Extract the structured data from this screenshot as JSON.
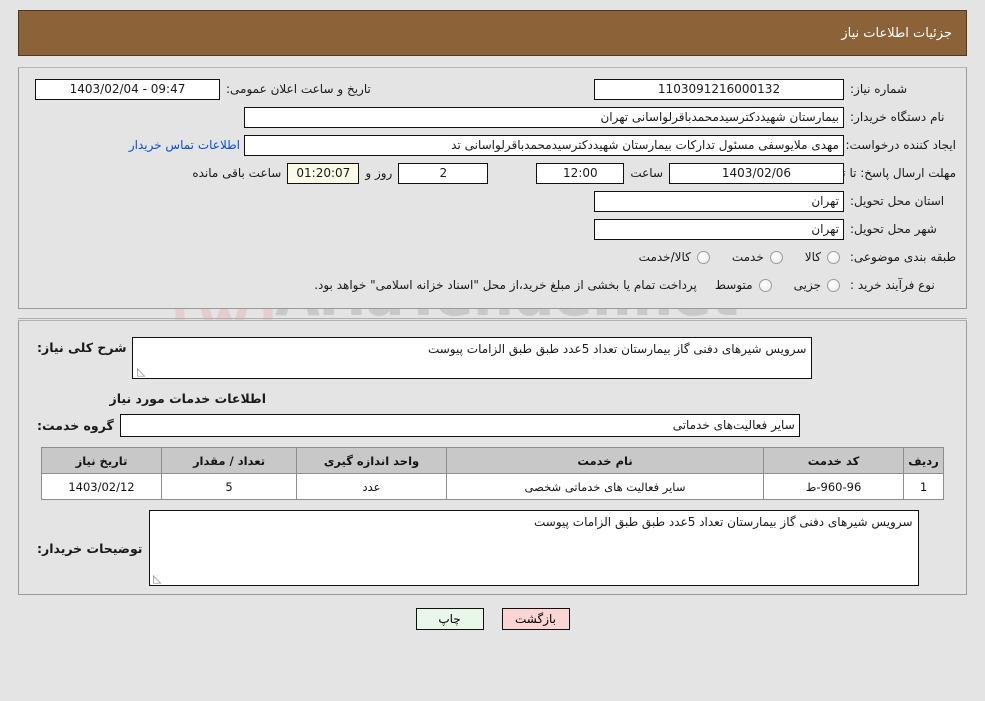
{
  "header": {
    "title": "جزئیات اطلاعات نیاز"
  },
  "watermark": {
    "text": "AriaTender.net",
    "shield": "shield-logo"
  },
  "form": {
    "need_number": {
      "label": "شماره نیاز:",
      "value": "1103091216000132"
    },
    "announce_datetime": {
      "label": "تاریخ و ساعت اعلان عمومی:",
      "value": "09:47 - 1403/02/04"
    },
    "buyer_org": {
      "label": "نام دستگاه خریدار:",
      "value": "بیمارستان شهیددکترسیدمحمدباقرلواسانی تهران"
    },
    "requester": {
      "label": "ایجاد کننده درخواست:",
      "value": "مهدی ملایوسفی مسئول تدارکات بیمارستان شهیددکترسیدمحمدباقرلواسانی تد",
      "contact_link": "اطلاعات تماس خریدار"
    },
    "deadline": {
      "label": "مهلت ارسال پاسخ: تا تاریخ:",
      "date": "1403/02/06",
      "hour_label": "ساعت",
      "hour": "12:00",
      "days": "2",
      "days_label": "روز و",
      "countdown": "01:20:07",
      "countdown_label": "ساعت باقی مانده"
    },
    "delivery_province": {
      "label": "استان محل تحویل:",
      "value": "تهران"
    },
    "delivery_city": {
      "label": "شهر محل تحویل:",
      "value": "تهران"
    },
    "category": {
      "label": "طبقه بندی موضوعی:",
      "options": [
        {
          "label": "کالا",
          "selected": false
        },
        {
          "label": "خدمت",
          "selected": false
        },
        {
          "label": "کالا/خدمت",
          "selected": false
        }
      ]
    },
    "purchase_type": {
      "label": "نوع فرآیند خرید :",
      "options": [
        {
          "label": "جزیی",
          "selected": false
        },
        {
          "label": "متوسط",
          "selected": false
        }
      ],
      "note": "پرداخت تمام یا بخشی از مبلغ خرید،از محل \"اسناد خزانه اسلامی\" خواهد بود."
    },
    "general_description": {
      "label": "شرح کلی نیاز:",
      "value": "سرویس شیرهای دفنی گاز بیمارستان  تعداد 5عدد طبق طبق الزامات پیوست"
    },
    "services_section_title": "اطلاعات خدمات مورد نیاز",
    "service_group": {
      "label": "گروه خدمت:",
      "value": "سایر فعالیت‌های خدماتی"
    },
    "buyer_notes": {
      "label": "توضیحات خریدار:",
      "value": "سرویس شیرهای دفنی گاز بیمارستان  تعداد 5عدد طبق طبق الزامات پیوست"
    }
  },
  "items_table": {
    "columns": [
      "ردیف",
      "کد خدمت",
      "نام خدمت",
      "واحد اندازه گیری",
      "تعداد / مقدار",
      "تاریخ نیاز"
    ],
    "rows": [
      {
        "row": "1",
        "code": "960-96-ط",
        "name": "سایر فعالیت های خدماتی شخصی",
        "unit": "عدد",
        "qty": "5",
        "date": "1403/02/12"
      }
    ]
  },
  "buttons": {
    "print": "چاپ",
    "back": "بازگشت"
  }
}
